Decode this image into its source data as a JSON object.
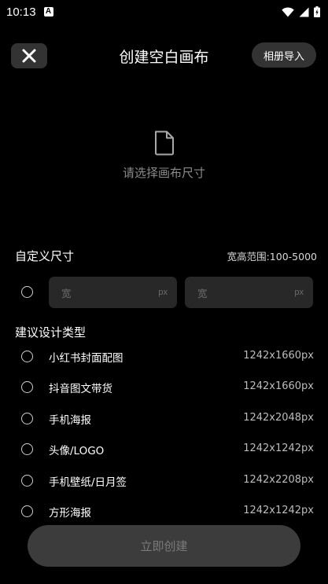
{
  "status_bar": {
    "time": "10:13",
    "notification_badge": "A"
  },
  "header": {
    "title": "创建空白画布",
    "import_label": "相册导入"
  },
  "empty_state": {
    "hint": "请选择画布尺寸"
  },
  "custom_size": {
    "title": "自定义尺寸",
    "range": "宽高范围:100-5000",
    "width_placeholder": "宽",
    "height_placeholder": "宽",
    "unit": "px"
  },
  "suggested": {
    "title": "建议设计类型",
    "items": [
      {
        "name": "小红书封面配图",
        "size": "1242x1660px"
      },
      {
        "name": "抖音图文带货",
        "size": "1242x1660px"
      },
      {
        "name": "手机海报",
        "size": "1242x2048px"
      },
      {
        "name": "头像/LOGO",
        "size": "1242x1242px"
      },
      {
        "name": "手机壁纸/日月签",
        "size": "1242x2208px"
      },
      {
        "name": "方形海报",
        "size": "1242x1242px"
      }
    ]
  },
  "create_label": "立即创建"
}
